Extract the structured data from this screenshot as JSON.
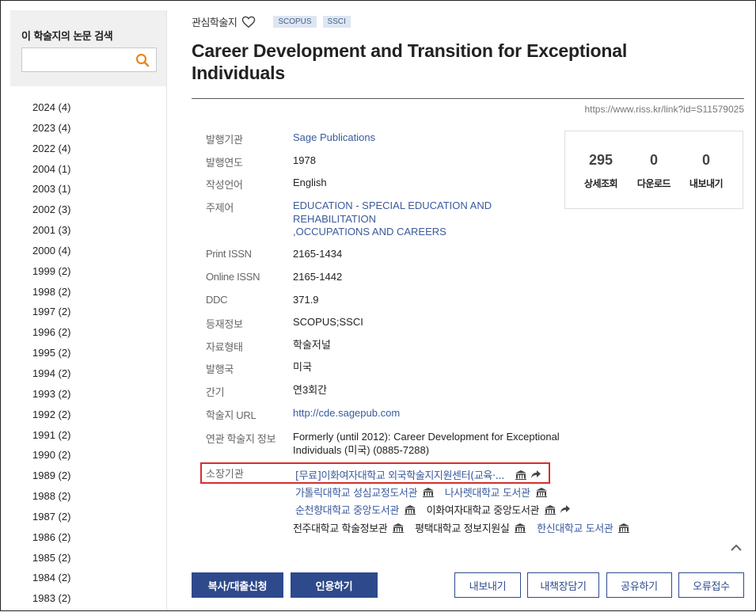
{
  "sidebar": {
    "search_title": "이 학술지의 논문 검색",
    "search_placeholder": "",
    "years": [
      "2024 (4)",
      "2023 (4)",
      "2022 (4)",
      "2004 (1)",
      "2003 (1)",
      "2002 (3)",
      "2001 (3)",
      "2000 (4)",
      "1999 (2)",
      "1998 (2)",
      "1997 (2)",
      "1996 (2)",
      "1995 (2)",
      "1994 (2)",
      "1993 (2)",
      "1992 (2)",
      "1991 (2)",
      "1990 (2)",
      "1989 (2)",
      "1988 (2)",
      "1987 (2)",
      "1986 (2)",
      "1985 (2)",
      "1984 (2)",
      "1983 (2)"
    ]
  },
  "header": {
    "fav_label": "관심학술지",
    "tags": [
      "SCOPUS",
      "SSCI"
    ],
    "title": "Career Development and Transition for Exceptional Individuals",
    "link": "https://www.riss.kr/link?id=S11579025"
  },
  "meta": {
    "publisher": {
      "label": "발행기관",
      "value": "Sage Publications"
    },
    "year": {
      "label": "발행연도",
      "value": "1978"
    },
    "language": {
      "label": "작성언어",
      "value": "English"
    },
    "subject": {
      "label": "주제어",
      "value_1": "EDUCATION - SPECIAL EDUCATION AND",
      "value_2": "REHABILITATION",
      "value_3": ",OCCUPATIONS AND CAREERS"
    },
    "print_issn": {
      "label": "Print ISSN",
      "value": "2165-1434"
    },
    "online_issn": {
      "label": "Online ISSN",
      "value": "2165-1442"
    },
    "ddc": {
      "label": "DDC",
      "value": "371.9"
    },
    "indexed": {
      "label": "등재정보",
      "value": "SCOPUS;SSCI"
    },
    "type": {
      "label": "자료형태",
      "value": "학술저널"
    },
    "country": {
      "label": "발행국",
      "value": "미국"
    },
    "frequency": {
      "label": "간기",
      "value": "연3회간"
    },
    "url": {
      "label": "학술지 URL",
      "value": "http://cde.sagepub.com"
    },
    "related": {
      "label": "연관 학술지 정보",
      "value_1": "Formerly (until 2012): Career Development for Exceptional",
      "value_2": "Individuals (미국) (0885-7288)"
    },
    "holdings": {
      "label": "소장기관"
    }
  },
  "holdings": {
    "row1": [
      "[무료]이화여자대학교 외국학술지지원센터(교육·..."
    ],
    "row2": [
      "가톨릭대학교 성심교정도서관",
      "나사렛대학교 도서관"
    ],
    "row3": [
      "순천향대학교 중앙도서관",
      "이화여자대학교 중앙도서관"
    ],
    "row4": [
      "전주대학교 학술정보관",
      "평택대학교 정보지원실",
      "한신대학교 도서관"
    ]
  },
  "stats": {
    "views": {
      "num": "295",
      "label": "상세조회"
    },
    "downloads": {
      "num": "0",
      "label": "다운로드"
    },
    "exports": {
      "num": "0",
      "label": "내보내기"
    }
  },
  "buttons": {
    "copy_request": "복사/대출신청",
    "cite": "인용하기",
    "export": "내보내기",
    "bookshelf": "내책장담기",
    "share": "공유하기",
    "report": "오류접수"
  },
  "colors": {
    "primary": "#2e4a8c",
    "link": "#3a5a9c",
    "highlight": "#d32f2f",
    "search_icon": "#e8871e"
  }
}
